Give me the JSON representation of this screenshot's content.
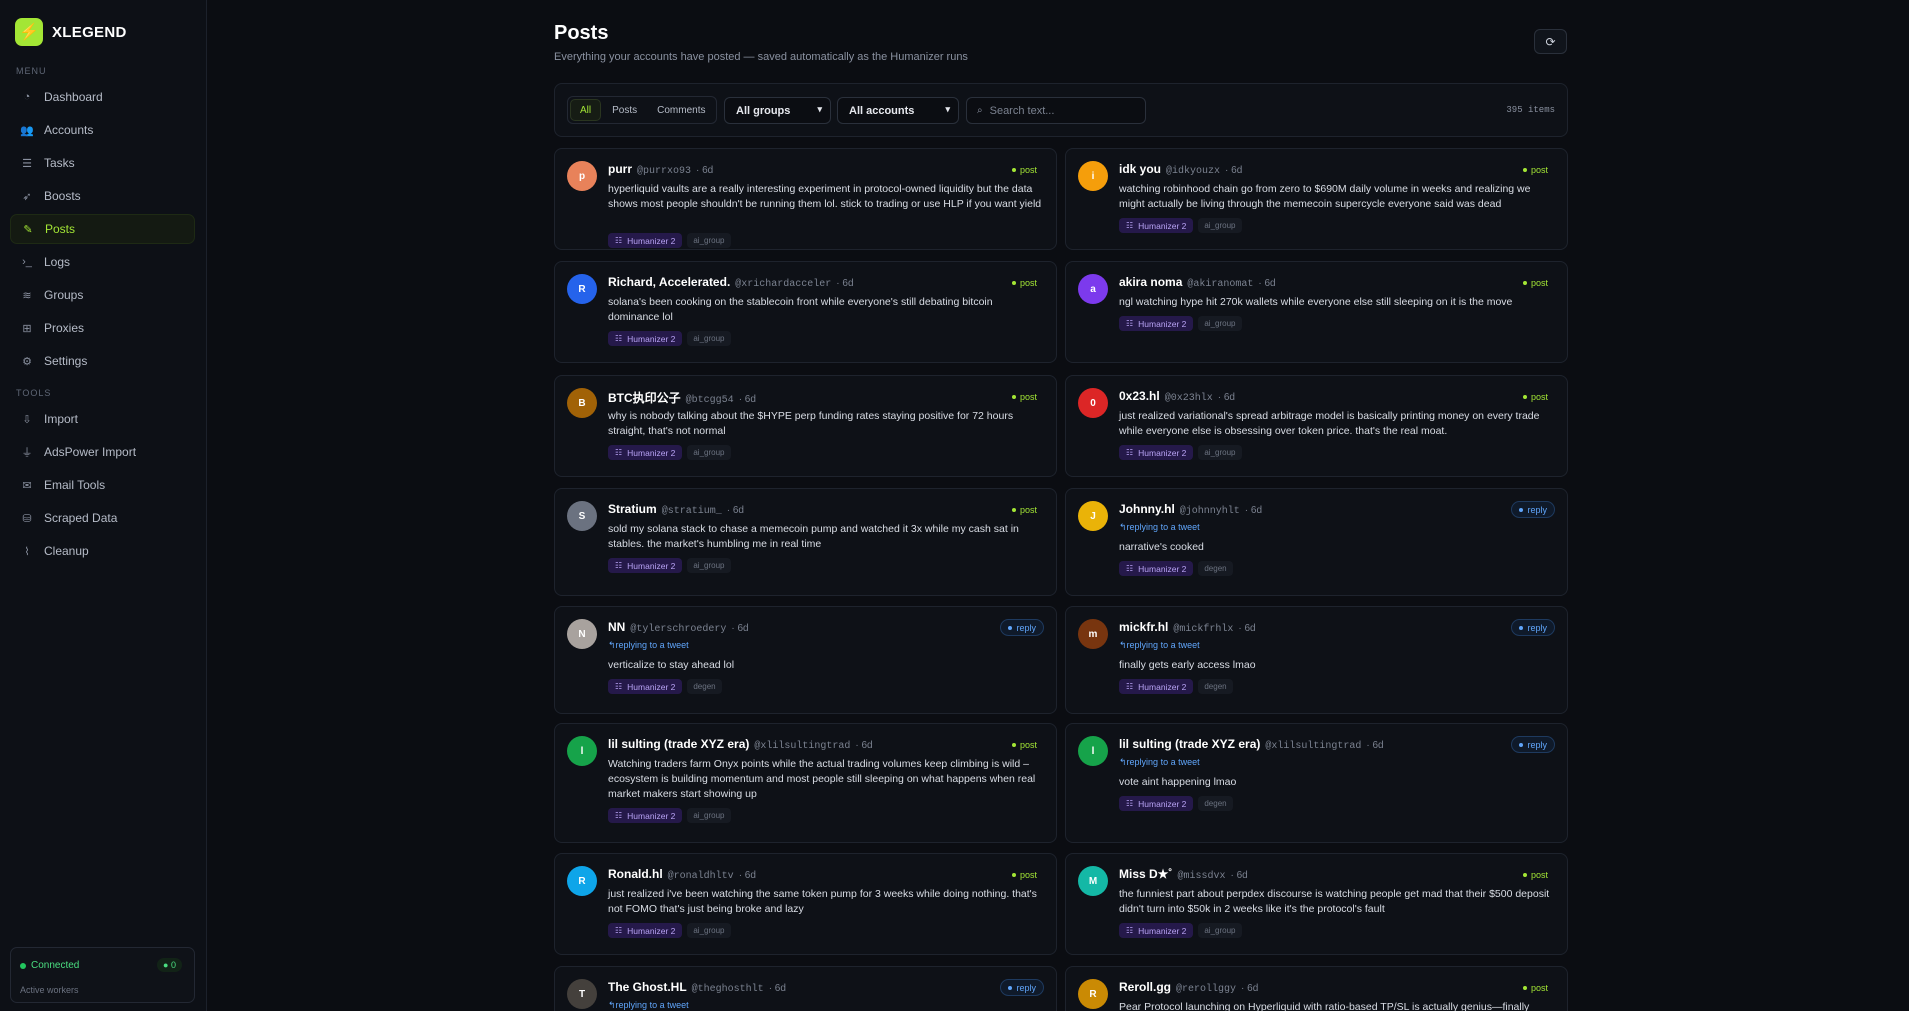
{
  "brand": {
    "name": "XLEGEND",
    "logo": "bolt-icon"
  },
  "sidebar": {
    "menu_label": "MENU",
    "menu": [
      {
        "label": "Dashboard",
        "icon": "gauge-icon"
      },
      {
        "label": "Accounts",
        "icon": "users-icon"
      },
      {
        "label": "Tasks",
        "icon": "list-icon"
      },
      {
        "label": "Boosts",
        "icon": "rocket-icon"
      },
      {
        "label": "Posts",
        "icon": "feather-icon",
        "active": true
      },
      {
        "label": "Logs",
        "icon": "terminal-icon"
      },
      {
        "label": "Groups",
        "icon": "layers-icon"
      },
      {
        "label": "Proxies",
        "icon": "network-icon"
      },
      {
        "label": "Settings",
        "icon": "gear-icon"
      }
    ],
    "tools_label": "TOOLS",
    "tools": [
      {
        "label": "Import",
        "icon": "import-icon"
      },
      {
        "label": "AdsPower Import",
        "icon": "plug-icon"
      },
      {
        "label": "Email Tools",
        "icon": "mail-icon"
      },
      {
        "label": "Scraped Data",
        "icon": "database-icon"
      },
      {
        "label": "Cleanup",
        "icon": "broom-icon"
      }
    ],
    "status": {
      "label": "Connected",
      "workers": "0",
      "sub": "Active workers"
    }
  },
  "page": {
    "title": "Posts",
    "subtitle": "Everything your accounts have posted — saved automatically as the Humanizer runs"
  },
  "toolbar": {
    "tabs": [
      "All",
      "Posts",
      "Comments"
    ],
    "active_tab": "All",
    "group_select": "All groups",
    "account_select": "All accounts",
    "search_placeholder": "Search text...",
    "count": "395 items"
  },
  "colors": {
    "accent": "#a3e635",
    "reply": "#60a5fa",
    "group_tag": "#b9a3f5"
  },
  "posts": [
    {
      "name": "purr",
      "handle": "@purrxo93",
      "time": "6d",
      "type": "post",
      "avatar_color": "#e8825a",
      "text": "hyperliquid vaults are a really interesting experiment in protocol-owned liquidity but the data shows most people shouldn't be running them lol. stick to trading or use HLP if you want yield",
      "group": "Humanizer 2",
      "account_group": "ai_group"
    },
    {
      "name": "idk you",
      "handle": "@idkyouzx",
      "time": "6d",
      "type": "post",
      "avatar_color": "#f59e0b",
      "text": "watching robinhood chain go from zero to $690M daily volume in weeks and realizing we might actually be living through the memecoin supercycle everyone said was dead",
      "group": "Humanizer 2",
      "account_group": "ai_group"
    },
    {
      "name": "Richard, Accelerated.",
      "handle": "@xrichardacceler",
      "time": "6d",
      "type": "post",
      "avatar_color": "#2563eb",
      "text": "solana's been cooking on the stablecoin front while everyone's still debating bitcoin dominance lol",
      "group": "Humanizer 2",
      "account_group": "ai_group"
    },
    {
      "name": "akira noma",
      "handle": "@akiranomat",
      "time": "6d",
      "type": "post",
      "avatar_color": "#7c3aed",
      "text": "ngl watching hype hit 270k wallets while everyone else still sleeping on it is the move",
      "group": "Humanizer 2",
      "account_group": "ai_group"
    },
    {
      "name": "BTC执印公子",
      "handle": "@btcgg54",
      "time": "6d",
      "type": "post",
      "avatar_color": "#a16207",
      "text": "why is nobody talking about the $HYPE perp funding rates staying positive for 72 hours straight, that's not normal",
      "group": "Humanizer 2",
      "account_group": "ai_group"
    },
    {
      "name": "0x23.hl",
      "handle": "@0x23hlx",
      "time": "6d",
      "type": "post",
      "avatar_color": "#dc2626",
      "text": "just realized variational's spread arbitrage model is basically printing money on every trade while everyone else is obsessing over token price. that's the real moat.",
      "group": "Humanizer 2",
      "account_group": "ai_group"
    },
    {
      "name": "Stratium",
      "handle": "@stratium_",
      "time": "6d",
      "type": "post",
      "avatar_color": "#6b7280",
      "text": "sold my solana stack to chase a memecoin pump and watched it 3x while my cash sat in stables. the market's humbling me in real time",
      "group": "Humanizer 2",
      "account_group": "ai_group"
    },
    {
      "name": "Johnny.hl",
      "handle": "@johnnyhlt",
      "time": "6d",
      "type": "reply",
      "replying": "replying to a tweet",
      "avatar_color": "#eab308",
      "text": "narrative's cooked",
      "group": "Humanizer 2",
      "account_group": "degen"
    },
    {
      "name": "NN",
      "handle": "@tylerschroedery",
      "time": "6d",
      "type": "reply",
      "replying": "replying to a tweet",
      "avatar_color": "#a8a29e",
      "text": "verticalize to stay ahead lol",
      "group": "Humanizer 2",
      "account_group": "degen"
    },
    {
      "name": "mickfr.hl",
      "handle": "@mickfrhlx",
      "time": "6d",
      "type": "reply",
      "replying": "replying to a tweet",
      "avatar_color": "#78350f",
      "text": "finally gets early access lmao",
      "group": "Humanizer 2",
      "account_group": "degen"
    },
    {
      "name": "lil sulting (trade XYZ era)",
      "handle": "@xlilsultingtrad",
      "time": "6d",
      "type": "post",
      "avatar_color": "#16a34a",
      "text": "Watching traders farm Onyx points while the actual trading volumes keep climbing is wild – ecosystem is building momentum and most people still sleeping on what happens when real market makers start showing up",
      "group": "Humanizer 2",
      "account_group": "ai_group"
    },
    {
      "name": "lil sulting (trade XYZ era)",
      "handle": "@xlilsultingtrad",
      "time": "6d",
      "type": "reply",
      "replying": "replying to a tweet",
      "avatar_color": "#16a34a",
      "text": "vote aint happening lmao",
      "group": "Humanizer 2",
      "account_group": "degen"
    },
    {
      "name": "Ronald.hl",
      "handle": "@ronaldhltv",
      "time": "6d",
      "type": "post",
      "avatar_color": "#0ea5e9",
      "text": "just realized i've been watching the same token pump for 3 weeks while doing nothing. that's not FOMO that's just being broke and lazy",
      "group": "Humanizer 2",
      "account_group": "ai_group"
    },
    {
      "name": "Miss D★˚",
      "handle": "@missdvx",
      "time": "6d",
      "type": "post",
      "avatar_color": "#14b8a6",
      "text": "the funniest part about perpdex discourse is watching people get mad that their $500 deposit didn't turn into $50k in 2 weeks like it's the protocol's fault",
      "group": "Humanizer 2",
      "account_group": "ai_group"
    },
    {
      "name": "The Ghost.HL",
      "handle": "@theghosthlt",
      "time": "6d",
      "type": "reply",
      "replying": "replying to a tweet",
      "avatar_color": "#44403c",
      "text": "",
      "group": "",
      "account_group": ""
    },
    {
      "name": "Reroll.gg",
      "handle": "@rerollggy",
      "time": "6d",
      "type": "post",
      "avatar_color": "#ca8a04",
      "text": "Pear Protocol launching on Hyperliquid with ratio-based TP/SL is actually genius—finally",
      "group": "",
      "account_group": ""
    }
  ]
}
